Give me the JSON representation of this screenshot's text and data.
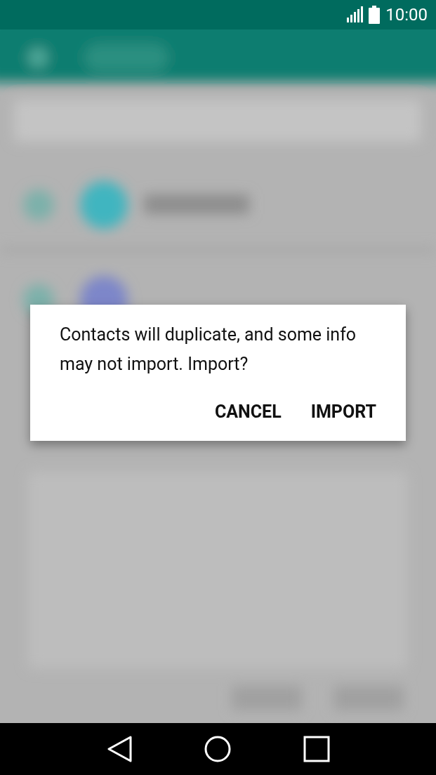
{
  "status_bar": {
    "time": "10:00"
  },
  "dialog": {
    "message": "Contacts will duplicate, and some info may not import. Import?",
    "buttons": [
      "CANCEL",
      "IMPORT"
    ]
  }
}
